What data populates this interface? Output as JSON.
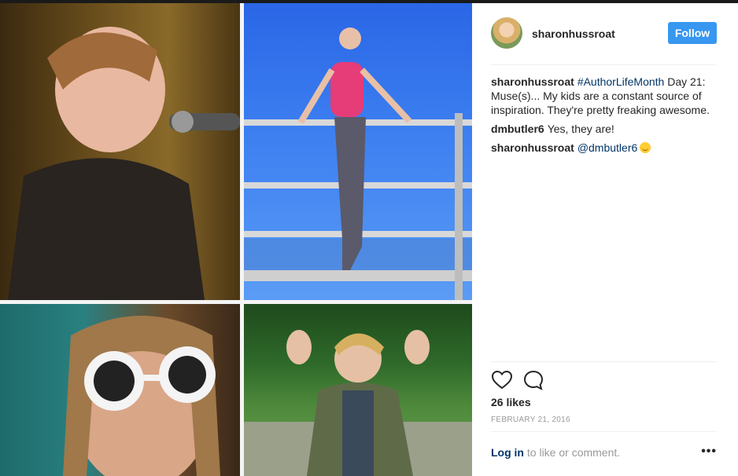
{
  "post": {
    "username": "sharonhussroat",
    "follow_label": "Follow",
    "likes": "26 likes",
    "date": "FEBRUARY 21, 2016",
    "login_link": "Log in",
    "login_rest": " to like or comment.",
    "more": "•••"
  },
  "comments": [
    {
      "user": "sharonhussroat",
      "tag": "#AuthorLifeMonth",
      "text": " Day 21: Muse(s)... My kids are a constant source of inspiration. They're pretty freaking awesome."
    },
    {
      "user": "dmbutler6",
      "text": "Yes, they are!"
    },
    {
      "user": "sharonhussroat",
      "tag": "@dmbutler6",
      "text": ""
    }
  ],
  "icons": {
    "like": "heart-icon",
    "comment": "comment-icon",
    "more": "more-options-icon"
  },
  "colors": {
    "follow_button": "#3897f0",
    "link": "#003569",
    "text": "#262626",
    "muted": "#999999"
  }
}
